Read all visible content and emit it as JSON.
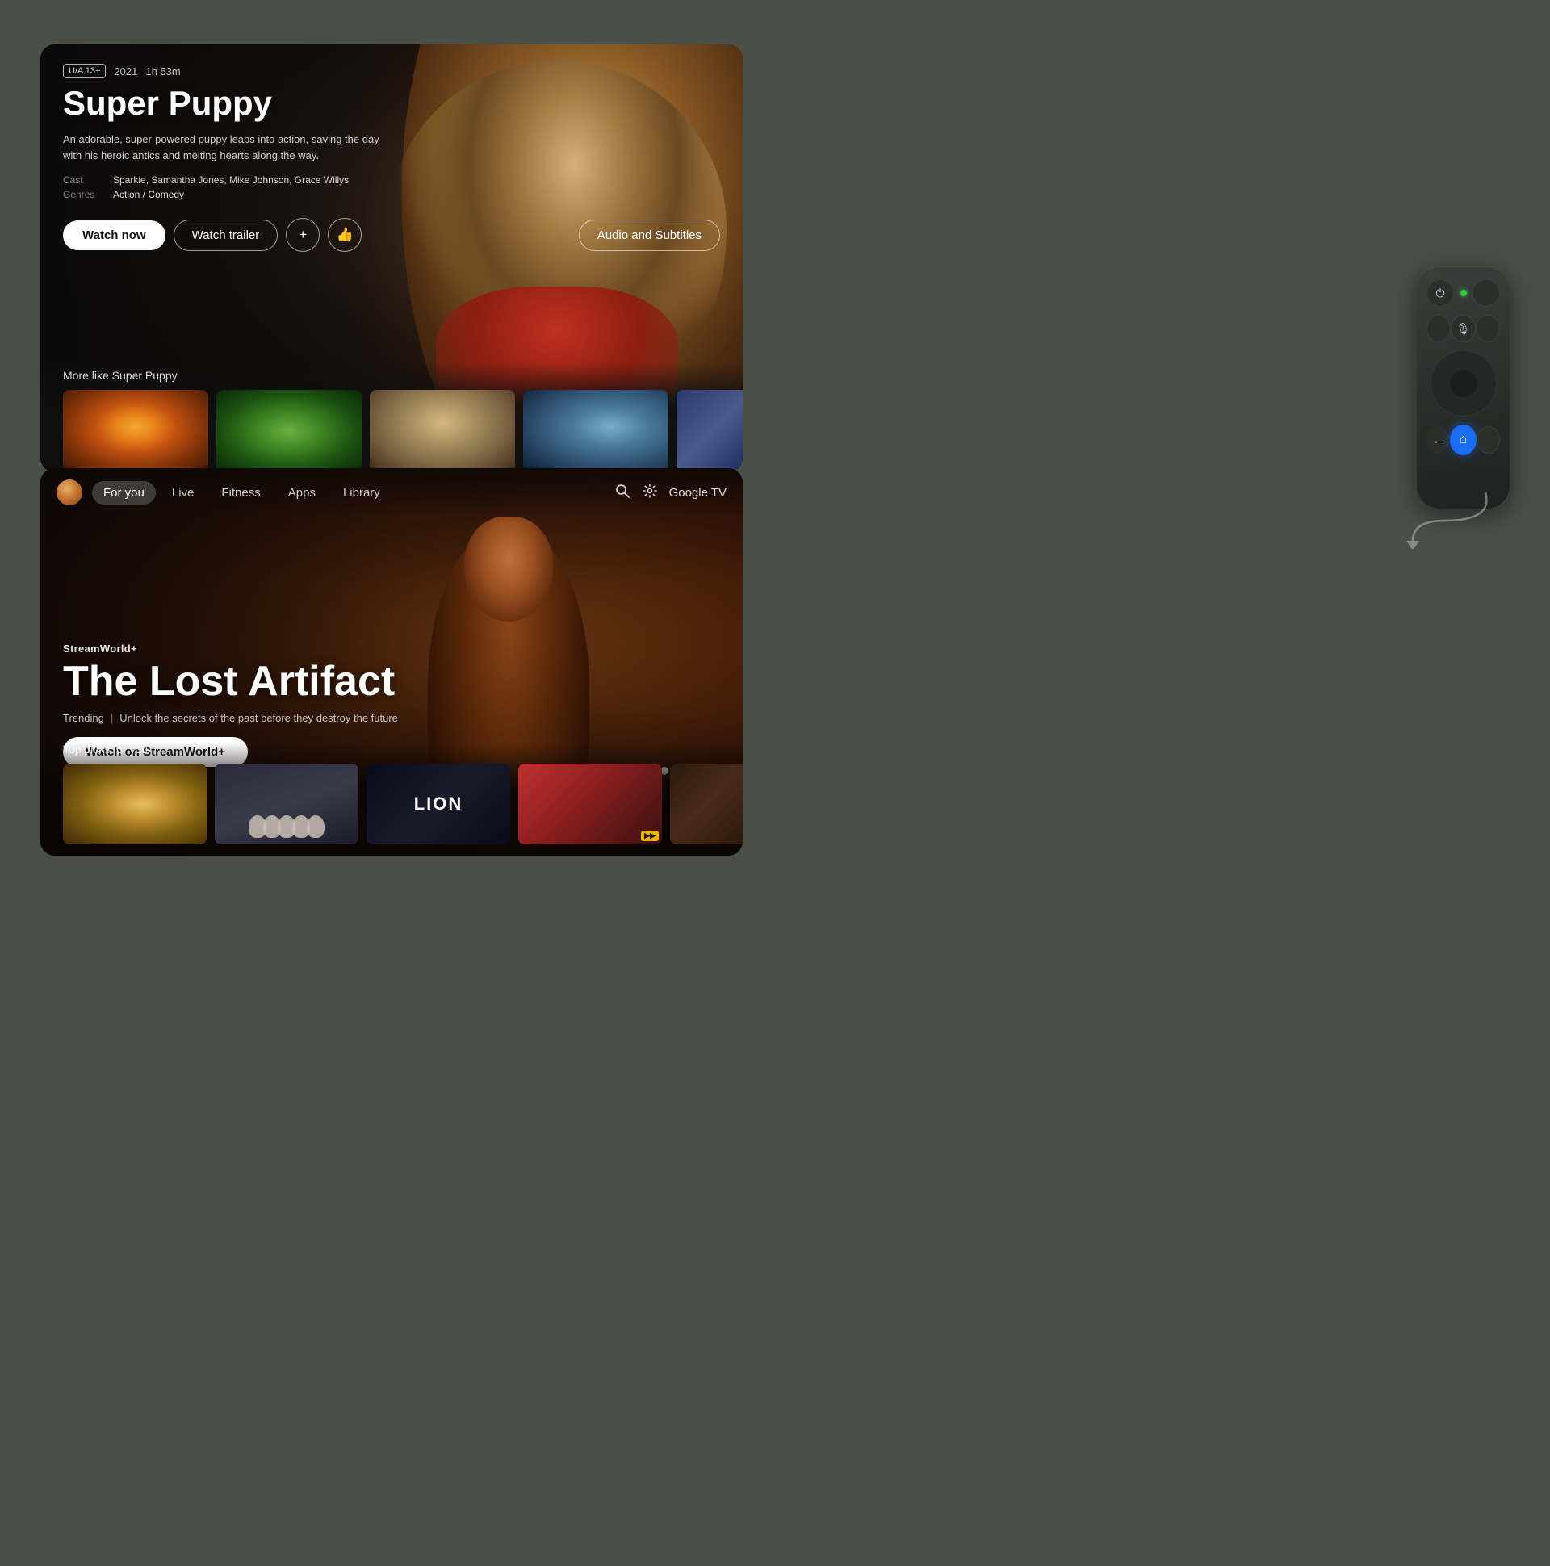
{
  "screen1": {
    "rating": "U/A 13+",
    "year": "2021",
    "duration": "1h 53m",
    "title": "Super Puppy",
    "description": "An adorable, super-powered puppy leaps into action, saving the day with his heroic antics and melting hearts along the way.",
    "cast_label": "Cast",
    "cast_value": "Sparkie, Samantha Jones, Mike Johnson, Grace Willys",
    "genres_label": "Genres",
    "genres_value": "Action / Comedy",
    "btn_watch_now": "Watch now",
    "btn_watch_trailer": "Watch trailer",
    "btn_add_icon": "+",
    "btn_like_icon": "👍",
    "btn_audio": "Audio and Subtitles",
    "more_like_title": "More like Super Puppy"
  },
  "screen2": {
    "nav": {
      "items": [
        "For you",
        "Live",
        "Fitness",
        "Apps",
        "Library"
      ],
      "active_index": 0,
      "brand": "Google TV"
    },
    "hero": {
      "streaming_brand": "StreamWorld+",
      "title": "The Lost Artifact",
      "trending_label": "Trending",
      "tagline": "Unlock the secrets of the past before they destroy the future",
      "btn_watch": "Watch on StreamWorld+"
    },
    "dots": [
      true,
      false,
      false,
      false,
      false
    ],
    "top_picks_title": "Top picks for you",
    "picks": [
      {
        "id": "desert",
        "type": "desert"
      },
      {
        "id": "faces",
        "type": "faces"
      },
      {
        "id": "lion",
        "label": "LION",
        "type": "lion"
      },
      {
        "id": "sports",
        "type": "sports",
        "badge": "▶▶"
      },
      {
        "id": "partial",
        "type": "partial"
      }
    ]
  },
  "remote": {
    "power_icon": "⏻",
    "mic_icon": "🎤",
    "back_icon": "←",
    "home_icon": "⌂"
  }
}
